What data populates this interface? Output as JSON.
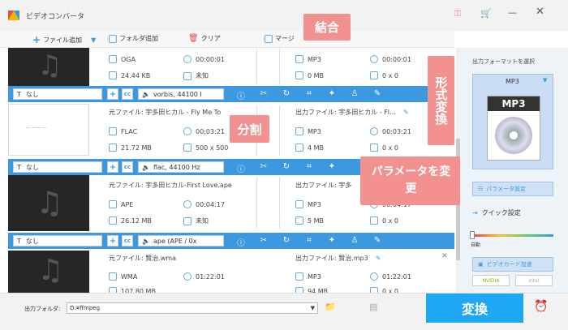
{
  "app": {
    "title": "ビデオコンバータ"
  },
  "toolbar": {
    "add_file": "ファイル追加",
    "add_folder": "フォルダ追加",
    "clear": "クリア",
    "merge": "マージ"
  },
  "items": [
    {
      "src_name": "",
      "src_format": "OGA",
      "src_duration": "00:00:01",
      "src_size": "24.44 KB",
      "src_res": "未知",
      "out_name": "",
      "out_format": "MP3",
      "out_duration": "00:00:01",
      "out_size": "0 MB",
      "out_res": "0 x 0",
      "subtitle": "なし",
      "audio": "vorbis, 44100 I"
    },
    {
      "src_name": "元ファイル: 宇多田ヒカル - Fly Me To",
      "src_format": "FLAC",
      "src_duration": "00:03:21",
      "src_size": "21.72 MB",
      "src_res": "500 x 500",
      "out_name": "出力ファイル: 宇多田ヒカル - Fl…",
      "out_format": "MP3",
      "out_duration": "00:03:21",
      "out_size": "4 MB",
      "out_res": "0 x 0",
      "subtitle": "なし",
      "audio": "flac, 44100 Hz"
    },
    {
      "src_name": "元ファイル: 宇多田ヒカル-First Love.ape",
      "src_format": "APE",
      "src_duration": "00:04:17",
      "src_size": "26.12 MB",
      "src_res": "未知",
      "out_name": "出力ファイル: 宇多",
      "out_format": "MP3",
      "out_duration": "00:04:17",
      "out_size": "5 MB",
      "out_res": "0 x 0",
      "subtitle": "なし",
      "audio": "ape (APE / 0x"
    },
    {
      "src_name": "元ファイル: 賢治.wma",
      "src_format": "WMA",
      "src_duration": "01:22:01",
      "src_size": "107.80 MB",
      "src_res": "",
      "out_name": "出力ファイル: 賢治.mp3",
      "out_format": "MP3",
      "out_duration": "01:22:01",
      "out_size": "94 MB",
      "out_res": "0 x 0",
      "subtitle": "",
      "audio": ""
    }
  ],
  "callouts": {
    "merge": "結合",
    "split": "分割",
    "format": "形式変換",
    "params": "パラメータを変更"
  },
  "right": {
    "format_label": "出力フォーマットを選択",
    "format_value": "MP3",
    "params_btn": "パラメータ設定",
    "quick_label": "クイック設定",
    "auto_label": "自動",
    "gpu_btn": "ビデオカード加速",
    "nvidia": "NVIDIA",
    "intel": "Intel"
  },
  "bottom": {
    "folder_label": "出力フォルダ:",
    "folder_value": "D:¥ffmpeg",
    "convert": "変換"
  },
  "colors": {
    "accent": "#3c99df",
    "callout": "#f39090",
    "convert": "#1ea7f5"
  }
}
